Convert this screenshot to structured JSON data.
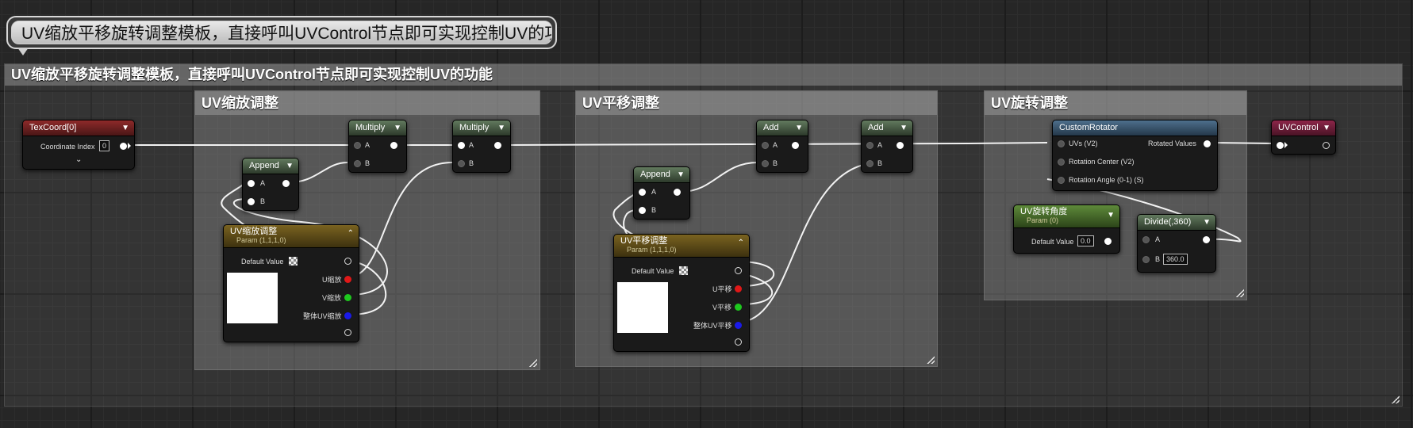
{
  "bubble_text": "UV缩放平移旋转调整模板，直接呼叫UVControl节点即可实现控制UV的功能",
  "main_comment_title": "UV缩放平移旋转调整模板，直接呼叫UVControl节点即可实现控制UV的功能",
  "sub_comments": {
    "scale": "UV缩放调整",
    "translate": "UV平移调整",
    "rotate": "UV旋转调整"
  },
  "nodes": {
    "texcoord": {
      "title": "TexCoord[0]",
      "pin_label": "Coordinate Index",
      "value": "0"
    },
    "multiply1": {
      "title": "Multiply",
      "pin_a": "A",
      "pin_b": "B"
    },
    "multiply2": {
      "title": "Multiply",
      "pin_a": "A",
      "pin_b": "B"
    },
    "append1": {
      "title": "Append",
      "pin_a": "A",
      "pin_b": "B"
    },
    "scale_param": {
      "title": "UV缩放调整",
      "subtitle": "Param (1,1,1,0)",
      "default_label": "Default Value",
      "out_u": "U缩放",
      "out_v": "V缩放",
      "out_all": "整体UV缩放"
    },
    "add1": {
      "title": "Add",
      "pin_a": "A",
      "pin_b": "B"
    },
    "add2": {
      "title": "Add",
      "pin_a": "A",
      "pin_b": "B"
    },
    "append2": {
      "title": "Append",
      "pin_a": "A",
      "pin_b": "B"
    },
    "translate_param": {
      "title": "UV平移调整",
      "subtitle": "Param (1,1,1,0)",
      "default_label": "Default Value",
      "out_u": "U平移",
      "out_v": "V平移",
      "out_all": "整体UV平移"
    },
    "rotator": {
      "title": "CustomRotator",
      "in_uvs": "UVs (V2)",
      "in_center": "Rotation Center (V2)",
      "in_angle": "Rotation Angle (0-1) (S)",
      "out": "Rotated Values"
    },
    "angle_param": {
      "title": "UV旋转角度",
      "subtitle": "Param (0)",
      "default_label": "Default Value",
      "value": "0.0"
    },
    "divide": {
      "title": "Divide(,360)",
      "pin_a": "A",
      "pin_b": "B",
      "b_value": "360.0"
    },
    "uvcontrol": {
      "title": "UVControl"
    }
  },
  "colors": {
    "header_red": "#8e2a2a",
    "header_green": "#627a5e",
    "header_gold": "#7a6320",
    "header_blue": "#4e6f8c",
    "header_pink": "#8c2549",
    "pin_red": "#e01818",
    "pin_green": "#1ec81e",
    "pin_blue": "#1a1ae8"
  }
}
